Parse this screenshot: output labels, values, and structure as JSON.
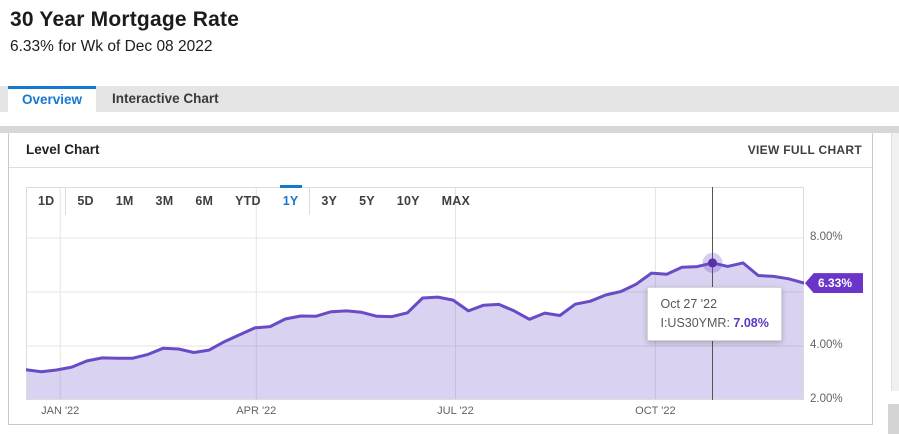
{
  "header": {
    "title": "30 Year Mortgage Rate",
    "subtitle": "6.33% for Wk of Dec 08 2022"
  },
  "tabs": [
    {
      "label": "Overview",
      "active": true
    },
    {
      "label": "Interactive Chart",
      "active": false
    }
  ],
  "panel": {
    "title": "Level Chart",
    "action_label": "VIEW FULL CHART"
  },
  "ranges": [
    {
      "label": "1D"
    },
    {
      "label": "5D",
      "separator_before": true
    },
    {
      "label": "1M"
    },
    {
      "label": "3M"
    },
    {
      "label": "6M"
    },
    {
      "label": "YTD"
    },
    {
      "label": "1Y",
      "active": true
    },
    {
      "label": "3Y",
      "separator_before": true
    },
    {
      "label": "5Y"
    },
    {
      "label": "10Y"
    },
    {
      "label": "MAX"
    }
  ],
  "chart_data": {
    "type": "area",
    "title": "Level Chart",
    "xlabel": "",
    "ylabel": "",
    "grid": true,
    "legend": false,
    "ylim": [
      2,
      9.89
    ],
    "y_ticks": [
      {
        "label": "8.00%",
        "value": 8
      },
      {
        "label": "4.00%",
        "value": 4
      },
      {
        "label": "2.00%",
        "value": 2
      }
    ],
    "y_gridlines": [
      8,
      6,
      4
    ],
    "x_ticks": [
      {
        "label": "JAN '22",
        "frac": 0.044
      },
      {
        "label": "APR '22",
        "frac": 0.296
      },
      {
        "label": "JUL '22",
        "frac": 0.552
      },
      {
        "label": "OCT '22",
        "frac": 0.809
      }
    ],
    "x_dates": [
      "2021-12-16",
      "2021-12-23",
      "2021-12-30",
      "2022-01-06",
      "2022-01-13",
      "2022-01-20",
      "2022-01-27",
      "2022-02-03",
      "2022-02-10",
      "2022-02-17",
      "2022-02-24",
      "2022-03-03",
      "2022-03-10",
      "2022-03-17",
      "2022-03-24",
      "2022-03-31",
      "2022-04-07",
      "2022-04-14",
      "2022-04-21",
      "2022-04-28",
      "2022-05-05",
      "2022-05-12",
      "2022-05-19",
      "2022-05-26",
      "2022-06-02",
      "2022-06-09",
      "2022-06-16",
      "2022-06-23",
      "2022-06-30",
      "2022-07-07",
      "2022-07-14",
      "2022-07-21",
      "2022-07-28",
      "2022-08-04",
      "2022-08-11",
      "2022-08-18",
      "2022-08-25",
      "2022-09-01",
      "2022-09-08",
      "2022-09-15",
      "2022-09-22",
      "2022-09-29",
      "2022-10-06",
      "2022-10-13",
      "2022-10-20",
      "2022-10-27",
      "2022-11-03",
      "2022-11-10",
      "2022-11-17",
      "2022-11-23",
      "2022-12-01",
      "2022-12-08"
    ],
    "series": [
      {
        "name": "I:US30YMR",
        "values": [
          3.12,
          3.05,
          3.11,
          3.22,
          3.45,
          3.56,
          3.55,
          3.55,
          3.69,
          3.92,
          3.89,
          3.76,
          3.85,
          4.16,
          4.42,
          4.67,
          4.72,
          5.0,
          5.11,
          5.1,
          5.27,
          5.3,
          5.25,
          5.1,
          5.09,
          5.23,
          5.78,
          5.81,
          5.7,
          5.3,
          5.51,
          5.54,
          5.3,
          4.99,
          5.22,
          5.13,
          5.55,
          5.66,
          5.89,
          6.02,
          6.29,
          6.7,
          6.66,
          6.92,
          6.94,
          7.08,
          6.95,
          7.08,
          6.61,
          6.58,
          6.49,
          6.33
        ]
      }
    ],
    "tooltip": {
      "date": "Oct 27 '22",
      "series_label": "I:US30YMR:",
      "value": "7.08%",
      "index": 45
    },
    "badge_label": "6.33%",
    "colors": {
      "line": "#6a4bc6",
      "fill": "rgba(106,75,198,0.25)",
      "marker": "#5531ad",
      "halo": "rgba(106,75,198,0.28)",
      "crosshair": "#555555",
      "gridline": "#e4e4e4",
      "plot_border": "#dcdcdc",
      "badge_bg": "#6a35c8",
      "accent": "#1878d0"
    }
  }
}
